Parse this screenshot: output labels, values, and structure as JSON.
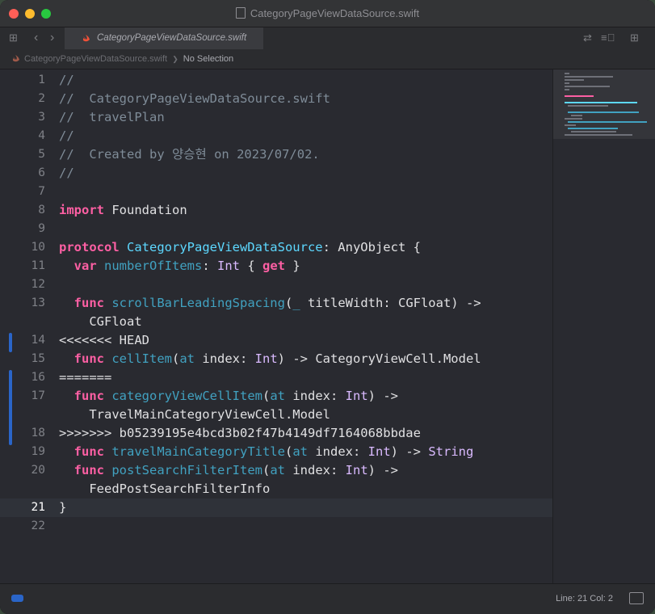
{
  "window": {
    "title": "CategoryPageViewDataSource.swift"
  },
  "tab": {
    "label": "CategoryPageViewDataSource.swift"
  },
  "jumpbar": {
    "file": "CategoryPageViewDataSource.swift",
    "separator": "❯",
    "symbol": "No Selection"
  },
  "editor": {
    "current_line": 21,
    "lines": [
      {
        "n": "1",
        "html": "<span class=\"cmt\">//</span>"
      },
      {
        "n": "2",
        "html": "<span class=\"cmt\">//  CategoryPageViewDataSource.swift</span>"
      },
      {
        "n": "3",
        "html": "<span class=\"cmt\">//  travelPlan</span>"
      },
      {
        "n": "4",
        "html": "<span class=\"cmt\">//</span>"
      },
      {
        "n": "5",
        "html": "<span class=\"cmt\">//  Created by 양승현 on 2023/07/02.</span>"
      },
      {
        "n": "6",
        "html": "<span class=\"cmt\">//</span>"
      },
      {
        "n": "7",
        "html": ""
      },
      {
        "n": "8",
        "html": "<span class=\"kw\">import</span> Foundation"
      },
      {
        "n": "9",
        "html": ""
      },
      {
        "n": "10",
        "html": "<span class=\"kw\">protocol</span> <span class=\"decl\">CategoryPageViewDataSource</span>: AnyObject {"
      },
      {
        "n": "11",
        "html": "  <span class=\"kw\">var</span> <span class=\"fnd\">numberOfItems</span>: <span class=\"sys\">Int</span> { <span class=\"kw\">get</span> }"
      },
      {
        "n": "12",
        "html": ""
      },
      {
        "n": "13",
        "html": "  <span class=\"kw\">func</span> <span class=\"fnd\">scrollBarLeadingSpacing</span>(<span class=\"fnd\">_</span> titleWidth: CGFloat) ->"
      },
      {
        "n": "",
        "html": "    CGFloat"
      },
      {
        "n": "14",
        "html": "<<<<<<< HEAD"
      },
      {
        "n": "15",
        "html": "  <span class=\"kw\">func</span> <span class=\"fnd\">cellItem</span>(<span class=\"fnd\">at</span> index: <span class=\"sys\">Int</span>) -> CategoryViewCell.Model"
      },
      {
        "n": "16",
        "html": "======="
      },
      {
        "n": "17",
        "html": "  <span class=\"kw\">func</span> <span class=\"fnd\">categoryViewCellItem</span>(<span class=\"fnd\">at</span> index: <span class=\"sys\">Int</span>) ->"
      },
      {
        "n": "",
        "html": "    TravelMainCategoryViewCell.Model"
      },
      {
        "n": "18",
        "html": ">>>>>>> b05239195e4bcd3b02f47b4149df7164068bbdae"
      },
      {
        "n": "19",
        "html": "  <span class=\"kw\">func</span> <span class=\"fnd\">travelMainCategoryTitle</span>(<span class=\"fnd\">at</span> index: <span class=\"sys\">Int</span>) -> <span class=\"sys\">String</span>"
      },
      {
        "n": "20",
        "html": "  <span class=\"kw\">func</span> <span class=\"fnd\">postSearchFilterItem</span>(<span class=\"fnd\">at</span> index: <span class=\"sys\">Int</span>) ->"
      },
      {
        "n": "",
        "html": "    FeedPostSearchFilterInfo"
      },
      {
        "n": "21",
        "html": "}"
      },
      {
        "n": "22",
        "html": ""
      }
    ]
  },
  "status": {
    "position": "Line: 21  Col: 2"
  },
  "colors": {
    "keyword": "#fc5fa3",
    "declaration": "#5dd8ff",
    "function": "#41a1c0",
    "type": "#dabaff",
    "comment": "#7f8c98",
    "change_bar": "#2a65c8"
  },
  "icons": [
    "close-icon",
    "minimize-icon",
    "zoom-icon",
    "grid-icon",
    "back-chevron-icon",
    "forward-chevron-icon",
    "swift-icon",
    "swap-icon",
    "inspector-icon",
    "add-editor-icon",
    "sidebar-toggle-icon"
  ]
}
